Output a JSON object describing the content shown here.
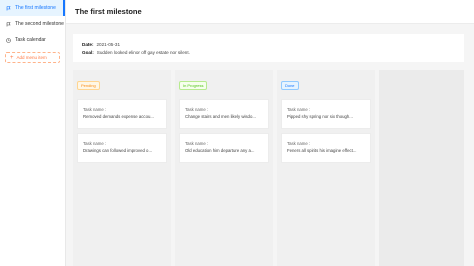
{
  "sidebar": {
    "items": [
      {
        "label": "The first milestone",
        "icon": "flag-icon",
        "active": true
      },
      {
        "label": "The second milestone",
        "icon": "flag-icon",
        "active": false
      },
      {
        "label": "Task calendar",
        "icon": "clock-icon",
        "active": false
      }
    ],
    "add_label": "Add menu item"
  },
  "header": {
    "title": "The first milestone"
  },
  "info": {
    "date_label": "Date",
    "date_value": "2021-05-31",
    "goal_label": "Goal",
    "goal_value": "Sudden looked elinor off gay estate nor silent."
  },
  "columns": [
    {
      "status": "Pending",
      "cards": [
        {
          "label": "Task name :",
          "value": "Removed demands expense accou..."
        },
        {
          "label": "Task name :",
          "value": "Drawings can followed improved o..."
        }
      ]
    },
    {
      "status": "In Progress",
      "cards": [
        {
          "label": "Task name :",
          "value": "Change stairs and men likely wisdo..."
        },
        {
          "label": "Task name :",
          "value": "Old education him departure any a..."
        }
      ]
    },
    {
      "status": "Done",
      "cards": [
        {
          "label": "Task name :",
          "value": "Pipped shy spring nor six though..."
        },
        {
          "label": "Task name :",
          "value": "Feners all spirits his imagine effect..."
        }
      ]
    }
  ],
  "colors": {
    "accent": "#1677ff",
    "pending": "#fa8c16",
    "in_progress": "#52c41a",
    "done": "#1677ff",
    "add": "#ff7a45"
  }
}
